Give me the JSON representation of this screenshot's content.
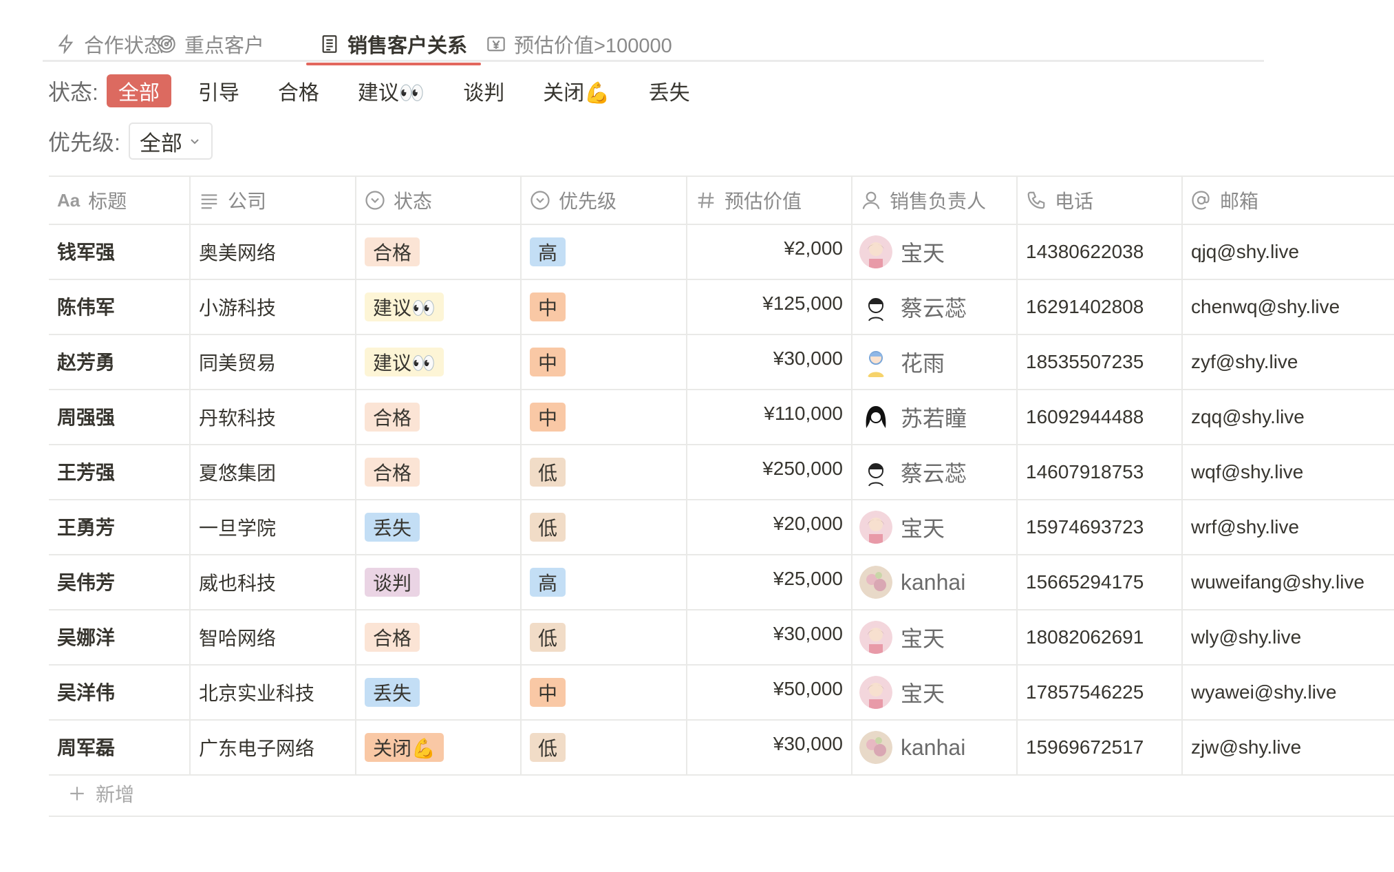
{
  "tabs": [
    {
      "label": "合作状态",
      "icon": "bolt-icon"
    },
    {
      "label": "重点客户",
      "icon": "target-icon"
    },
    {
      "label": "销售客户关系",
      "icon": "document-icon",
      "active": true
    },
    {
      "label": "预估价值>100000",
      "icon": "yen-icon"
    }
  ],
  "filters": {
    "status_label": "状态:",
    "status_options": [
      "全部",
      "引导",
      "合格",
      "建议👀",
      "谈判",
      "关闭💪",
      "丢失"
    ],
    "priority_label": "优先级:",
    "priority_value": "全部"
  },
  "table": {
    "headers": [
      "Aa",
      "标题",
      "公司",
      "状态",
      "优先级",
      "预估价值",
      "销售负责人",
      "电话",
      "邮箱"
    ],
    "rows": [
      {
        "title": "钱军强",
        "company": "奥美网络",
        "status": "合格",
        "priority": "高",
        "value": "¥2,000",
        "owner": "宝天",
        "phone": "14380622038",
        "email": "qjq@shy.live"
      },
      {
        "title": "陈伟军",
        "company": "小游科技",
        "status": "建议👀",
        "priority": "中",
        "value": "¥125,000",
        "owner": "蔡云蕊",
        "phone": "16291402808",
        "email": "chenwq@shy.live"
      },
      {
        "title": "赵芳勇",
        "company": "同美贸易",
        "status": "建议👀",
        "priority": "中",
        "value": "¥30,000",
        "owner": "花雨",
        "phone": "18535507235",
        "email": "zyf@shy.live"
      },
      {
        "title": "周强强",
        "company": "丹软科技",
        "status": "合格",
        "priority": "中",
        "value": "¥110,000",
        "owner": "苏若瞳",
        "phone": "16092944488",
        "email": "zqq@shy.live"
      },
      {
        "title": "王芳强",
        "company": "夏悠集团",
        "status": "合格",
        "priority": "低",
        "value": "¥250,000",
        "owner": "蔡云蕊",
        "phone": "14607918753",
        "email": "wqf@shy.live"
      },
      {
        "title": "王勇芳",
        "company": "一旦学院",
        "status": "丢失",
        "priority": "低",
        "value": "¥20,000",
        "owner": "宝天",
        "phone": "15974693723",
        "email": "wrf@shy.live"
      },
      {
        "title": "吴伟芳",
        "company": "威也科技",
        "status": "谈判",
        "priority": "高",
        "value": "¥25,000",
        "owner": "kanhai",
        "phone": "15665294175",
        "email": "wuweifang@shy.live"
      },
      {
        "title": "吴娜洋",
        "company": "智哈网络",
        "status": "合格",
        "priority": "低",
        "value": "¥30,000",
        "owner": "宝天",
        "phone": "18082062691",
        "email": "wly@shy.live"
      },
      {
        "title": "吴洋伟",
        "company": "北京实业科技",
        "status": "丢失",
        "priority": "中",
        "value": "¥50,000",
        "owner": "宝天",
        "phone": "17857546225",
        "email": "wyawei@shy.live"
      },
      {
        "title": "周军磊",
        "company": "广东电子网络",
        "status": "关闭💪",
        "priority": "低",
        "value": "¥30,000",
        "owner": "kanhai",
        "phone": "15969672517",
        "email": "zjw@shy.live"
      }
    ],
    "add_label": "新增"
  },
  "colors": {
    "accent": "#dc6a60",
    "status": {
      "合格": "#fbe4d5",
      "建议👀": "#fdf5d6",
      "丢失": "#c3def5",
      "谈判": "#ead4e4",
      "关闭💪": "#f9c8a5"
    },
    "priority": {
      "高": "#c3def5",
      "中": "#f9c8a5",
      "低": "#f1dcc7"
    }
  }
}
